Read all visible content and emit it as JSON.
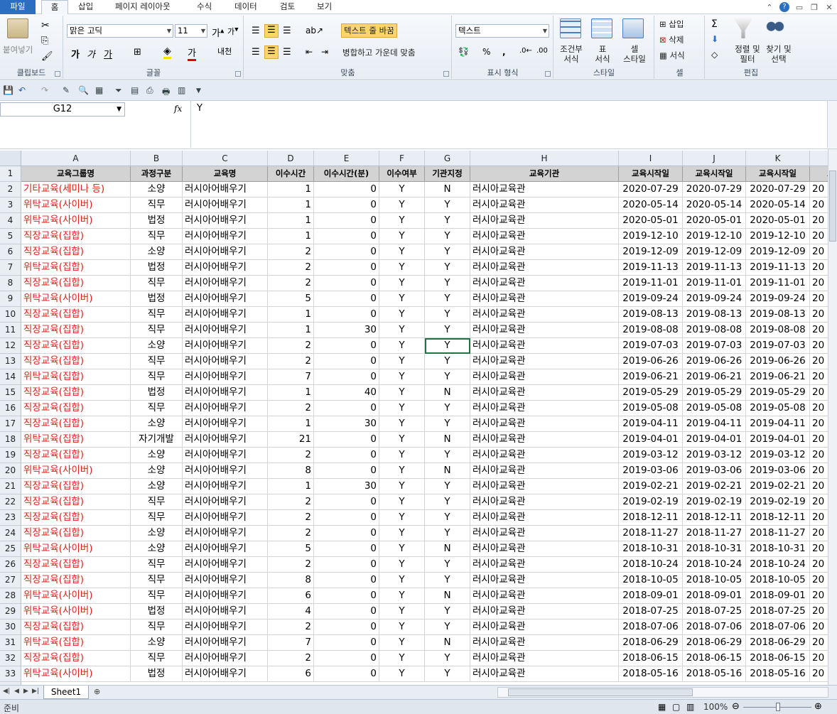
{
  "tabs": [
    "파일",
    "홈",
    "삽입",
    "페이지 레이아웃",
    "수식",
    "데이터",
    "검토",
    "보기"
  ],
  "ribbon": {
    "clipboard": {
      "label": "클립보드",
      "paste": "붙여넣기"
    },
    "font": {
      "label": "글꼴",
      "name": "맑은 고딕",
      "size": "11"
    },
    "alignment": {
      "label": "맞춤",
      "wrap": "텍스트 줄 바꿈",
      "merge": "병합하고 가운데 맞춤"
    },
    "number": {
      "label": "표시 형식",
      "format": "텍스트"
    },
    "styles": {
      "label": "스타일",
      "cond_1": "조건부",
      "cond_2": "서식",
      "table_1": "표",
      "table_2": "서식",
      "cell_1": "셀",
      "cell_2": "스타일"
    },
    "cells": {
      "label": "셀",
      "insert": "삽입",
      "delete": "삭제",
      "format": "서식"
    },
    "editing": {
      "label": "편집",
      "sort_1": "정렬 및",
      "sort_2": "필터",
      "find_1": "찾기 및",
      "find_2": "선택"
    }
  },
  "formula_bar": {
    "name_box": "G12",
    "fx": "fx",
    "content": "Y"
  },
  "columns": [
    "A",
    "B",
    "C",
    "D",
    "E",
    "F",
    "G",
    "H",
    "I",
    "J",
    "K",
    "L"
  ],
  "header_row": [
    "교육그룹명",
    "과정구분",
    "교육명",
    "이수시간",
    "이수시간(분)",
    "이수여부",
    "기관지정",
    "교육기관",
    "교육시작일",
    "교육시작일",
    "교육시작일",
    "교"
  ],
  "rows": [
    [
      "기타교육(세미나 등)",
      "소양",
      "러시아어배우기",
      "1",
      "0",
      "Y",
      "N",
      "러시아교육관",
      "2020-07-29",
      "2020-07-29",
      "2020-07-29",
      "20"
    ],
    [
      "위탁교육(사이버)",
      "직무",
      "러시아어배우기",
      "1",
      "0",
      "Y",
      "Y",
      "러시아교육관",
      "2020-05-14",
      "2020-05-14",
      "2020-05-14",
      "20"
    ],
    [
      "위탁교육(사이버)",
      "법정",
      "러시아어배우기",
      "1",
      "0",
      "Y",
      "Y",
      "러시아교육관",
      "2020-05-01",
      "2020-05-01",
      "2020-05-01",
      "20"
    ],
    [
      "직장교육(집합)",
      "직무",
      "러시아어배우기",
      "1",
      "0",
      "Y",
      "Y",
      "러시아교육관",
      "2019-12-10",
      "2019-12-10",
      "2019-12-10",
      "20"
    ],
    [
      "직장교육(집합)",
      "소양",
      "러시아어배우기",
      "2",
      "0",
      "Y",
      "Y",
      "러시아교육관",
      "2019-12-09",
      "2019-12-09",
      "2019-12-09",
      "20"
    ],
    [
      "위탁교육(집합)",
      "법정",
      "러시아어배우기",
      "2",
      "0",
      "Y",
      "Y",
      "러시아교육관",
      "2019-11-13",
      "2019-11-13",
      "2019-11-13",
      "20"
    ],
    [
      "직장교육(집합)",
      "직무",
      "러시아어배우기",
      "2",
      "0",
      "Y",
      "Y",
      "러시아교육관",
      "2019-11-01",
      "2019-11-01",
      "2019-11-01",
      "20"
    ],
    [
      "위탁교육(사이버)",
      "법정",
      "러시아어배우기",
      "5",
      "0",
      "Y",
      "Y",
      "러시아교육관",
      "2019-09-24",
      "2019-09-24",
      "2019-09-24",
      "20"
    ],
    [
      "직장교육(집합)",
      "직무",
      "러시아어배우기",
      "1",
      "0",
      "Y",
      "Y",
      "러시아교육관",
      "2019-08-13",
      "2019-08-13",
      "2019-08-13",
      "20"
    ],
    [
      "직장교육(집합)",
      "직무",
      "러시아어배우기",
      "1",
      "30",
      "Y",
      "Y",
      "러시아교육관",
      "2019-08-08",
      "2019-08-08",
      "2019-08-08",
      "20"
    ],
    [
      "직장교육(집합)",
      "소양",
      "러시아어배우기",
      "2",
      "0",
      "Y",
      "Y",
      "러시아교육관",
      "2019-07-03",
      "2019-07-03",
      "2019-07-03",
      "20"
    ],
    [
      "직장교육(집합)",
      "직무",
      "러시아어배우기",
      "2",
      "0",
      "Y",
      "Y",
      "러시아교육관",
      "2019-06-26",
      "2019-06-26",
      "2019-06-26",
      "20"
    ],
    [
      "위탁교육(집합)",
      "직무",
      "러시아어배우기",
      "7",
      "0",
      "Y",
      "Y",
      "러시아교육관",
      "2019-06-21",
      "2019-06-21",
      "2019-06-21",
      "20"
    ],
    [
      "직장교육(집합)",
      "법정",
      "러시아어배우기",
      "1",
      "40",
      "Y",
      "N",
      "러시아교육관",
      "2019-05-29",
      "2019-05-29",
      "2019-05-29",
      "20"
    ],
    [
      "직장교육(집합)",
      "직무",
      "러시아어배우기",
      "2",
      "0",
      "Y",
      "Y",
      "러시아교육관",
      "2019-05-08",
      "2019-05-08",
      "2019-05-08",
      "20"
    ],
    [
      "직장교육(집합)",
      "소양",
      "러시아어배우기",
      "1",
      "30",
      "Y",
      "Y",
      "러시아교육관",
      "2019-04-11",
      "2019-04-11",
      "2019-04-11",
      "20"
    ],
    [
      "위탁교육(집합)",
      "자기개발",
      "러시아어배우기",
      "21",
      "0",
      "Y",
      "N",
      "러시아교육관",
      "2019-04-01",
      "2019-04-01",
      "2019-04-01",
      "20"
    ],
    [
      "직장교육(집합)",
      "소양",
      "러시아어배우기",
      "2",
      "0",
      "Y",
      "Y",
      "러시아교육관",
      "2019-03-12",
      "2019-03-12",
      "2019-03-12",
      "20"
    ],
    [
      "위탁교육(사이버)",
      "소양",
      "러시아어배우기",
      "8",
      "0",
      "Y",
      "N",
      "러시아교육관",
      "2019-03-06",
      "2019-03-06",
      "2019-03-06",
      "20"
    ],
    [
      "직장교육(집합)",
      "소양",
      "러시아어배우기",
      "1",
      "30",
      "Y",
      "Y",
      "러시아교육관",
      "2019-02-21",
      "2019-02-21",
      "2019-02-21",
      "20"
    ],
    [
      "직장교육(집합)",
      "직무",
      "러시아어배우기",
      "2",
      "0",
      "Y",
      "Y",
      "러시아교육관",
      "2019-02-19",
      "2019-02-19",
      "2019-02-19",
      "20"
    ],
    [
      "직장교육(집합)",
      "직무",
      "러시아어배우기",
      "2",
      "0",
      "Y",
      "Y",
      "러시아교육관",
      "2018-12-11",
      "2018-12-11",
      "2018-12-11",
      "20"
    ],
    [
      "직장교육(집합)",
      "소양",
      "러시아어배우기",
      "2",
      "0",
      "Y",
      "Y",
      "러시아교육관",
      "2018-11-27",
      "2018-11-27",
      "2018-11-27",
      "20"
    ],
    [
      "위탁교육(사이버)",
      "소양",
      "러시아어배우기",
      "5",
      "0",
      "Y",
      "N",
      "러시아교육관",
      "2018-10-31",
      "2018-10-31",
      "2018-10-31",
      "20"
    ],
    [
      "직장교육(집합)",
      "직무",
      "러시아어배우기",
      "2",
      "0",
      "Y",
      "Y",
      "러시아교육관",
      "2018-10-24",
      "2018-10-24",
      "2018-10-24",
      "20"
    ],
    [
      "직장교육(집합)",
      "직무",
      "러시아어배우기",
      "8",
      "0",
      "Y",
      "Y",
      "러시아교육관",
      "2018-10-05",
      "2018-10-05",
      "2018-10-05",
      "20"
    ],
    [
      "위탁교육(사이버)",
      "직무",
      "러시아어배우기",
      "6",
      "0",
      "Y",
      "N",
      "러시아교육관",
      "2018-09-01",
      "2018-09-01",
      "2018-09-01",
      "20"
    ],
    [
      "위탁교육(사이버)",
      "법정",
      "러시아어배우기",
      "4",
      "0",
      "Y",
      "Y",
      "러시아교육관",
      "2018-07-25",
      "2018-07-25",
      "2018-07-25",
      "20"
    ],
    [
      "직장교육(집합)",
      "직무",
      "러시아어배우기",
      "2",
      "0",
      "Y",
      "Y",
      "러시아교육관",
      "2018-07-06",
      "2018-07-06",
      "2018-07-06",
      "20"
    ],
    [
      "위탁교육(집합)",
      "소양",
      "러시아어배우기",
      "7",
      "0",
      "Y",
      "N",
      "러시아교육관",
      "2018-06-29",
      "2018-06-29",
      "2018-06-29",
      "20"
    ],
    [
      "직장교육(집합)",
      "직무",
      "러시아어배우기",
      "2",
      "0",
      "Y",
      "Y",
      "러시아교육관",
      "2018-06-15",
      "2018-06-15",
      "2018-06-15",
      "20"
    ],
    [
      "위탁교육(사이버)",
      "법정",
      "러시아어배우기",
      "6",
      "0",
      "Y",
      "Y",
      "러시아교육관",
      "2018-05-16",
      "2018-05-16",
      "2018-05-16",
      "20"
    ]
  ],
  "sheet_tab": "Sheet1",
  "status": {
    "ready": "준비",
    "zoom": "100%"
  },
  "colors": {
    "accent": "#2a6fc2",
    "group_text": "#e3201b",
    "header_fill": "#d3d3d3"
  }
}
